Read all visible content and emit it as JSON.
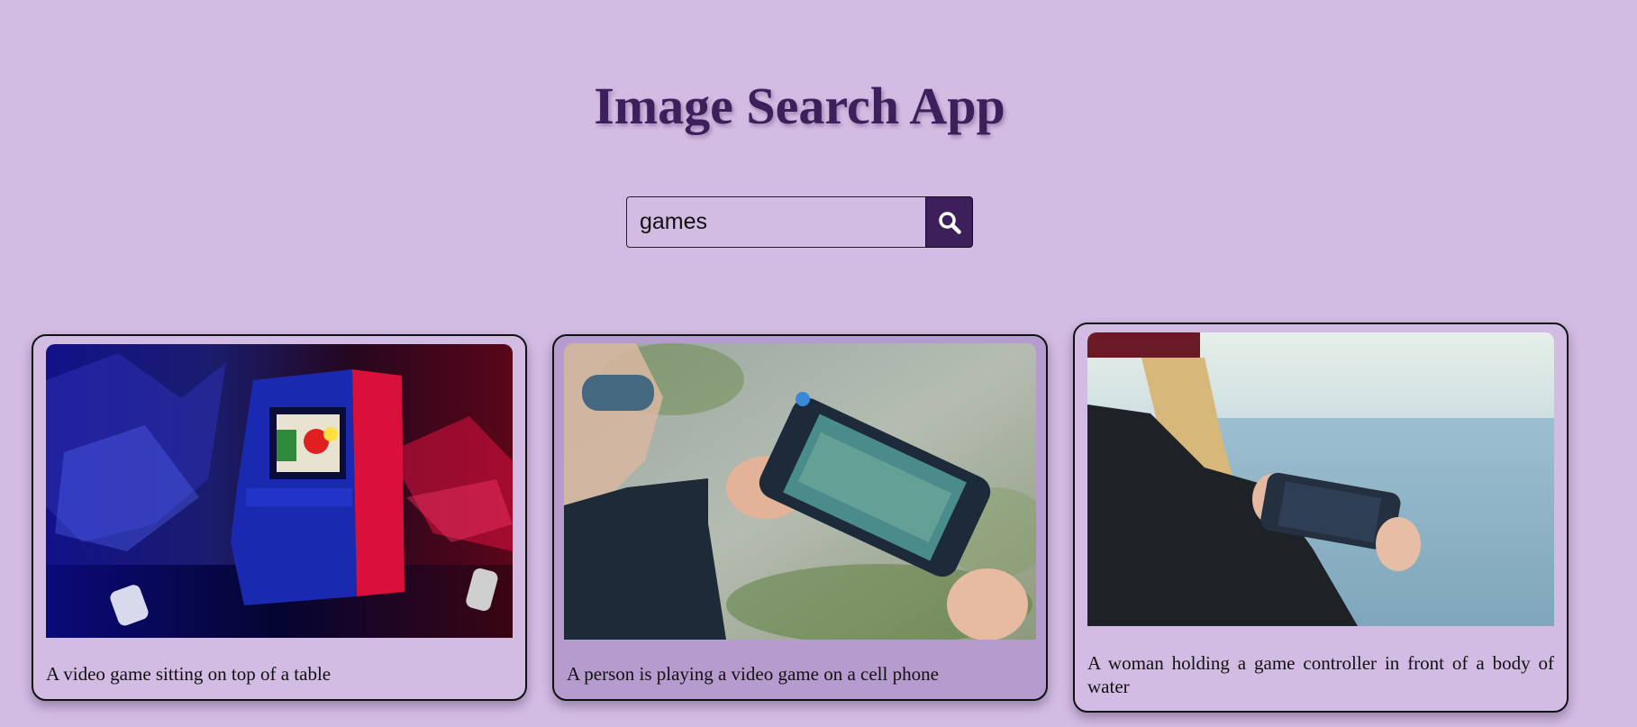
{
  "app": {
    "title": "Image Search App"
  },
  "search": {
    "value": "games",
    "button_icon": "search-icon"
  },
  "results": [
    {
      "caption": "A video game sitting on top of a table",
      "image_icon": "arcade-console-image"
    },
    {
      "caption": "A person is playing a video game on a cell phone",
      "image_icon": "handheld-console-image"
    },
    {
      "caption": "A woman holding a game controller in front of a body of water",
      "image_icon": "woman-console-sea-image"
    }
  ],
  "colors": {
    "background": "#d3bce3",
    "accent": "#3d1f5b",
    "card_hover": "#b69bcf"
  }
}
